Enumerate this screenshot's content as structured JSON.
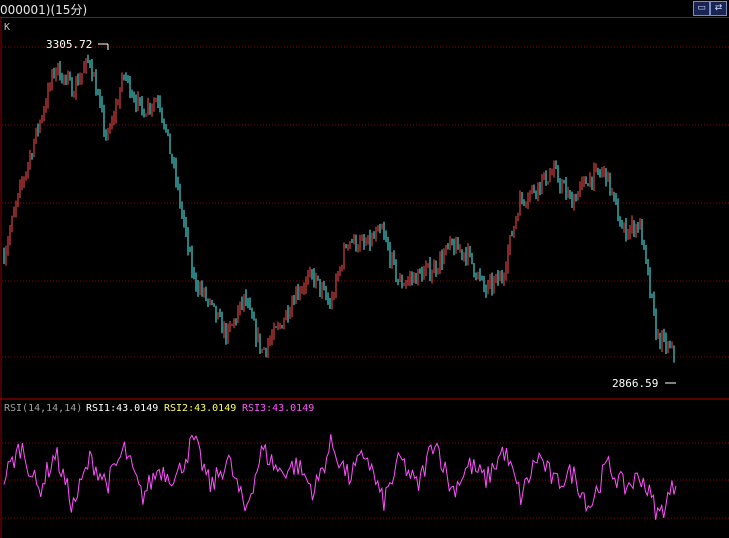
{
  "window": {
    "title": "000001)(15分)",
    "restore_icon": "restore-window-icon",
    "close_icon": "swap-window-icon"
  },
  "colors": {
    "up": "#ff5050",
    "down": "#54fcfc",
    "grid": "#8b0000",
    "rsi_line": "#ff50ff",
    "rsi1_label": "#ffffff",
    "rsi2_label": "#ffff54",
    "rsi3_label": "#ff54ff"
  },
  "panels": {
    "main_label": "K",
    "indicator_name": "RSI(14,14,14)",
    "rsi1_text": "RSI1:43.0149",
    "rsi2_text": "RSI2:43.0149",
    "rsi3_text": "RSI3:43.0149"
  },
  "chart_data": [
    {
      "type": "candlestick",
      "title": "K",
      "y_range": [
        2840,
        3345
      ],
      "grid": "horizontal dotted",
      "annotations": [
        {
          "label": "3305.72",
          "kind": "high"
        },
        {
          "label": "2866.59",
          "kind": "low"
        }
      ],
      "close_path": [
        3030,
        3120,
        3200,
        3280,
        3250,
        3290,
        3180,
        3270,
        3220,
        3240,
        3130,
        3000,
        2960,
        2920,
        2970,
        2900,
        2930,
        2980,
        3000,
        2960,
        3050,
        3040,
        3060,
        2990,
        3000,
        3010,
        3040,
        3030,
        2980,
        3000,
        3100,
        3120,
        3140,
        3100,
        3130,
        3140,
        3060,
        3070,
        2920,
        2895
      ]
    },
    {
      "type": "line",
      "title": "RSI(14,14,14)",
      "series": [
        {
          "name": "RSI1",
          "last": 43.0149
        },
        {
          "name": "RSI2",
          "last": 43.0149
        },
        {
          "name": "RSI3",
          "last": 43.0149
        }
      ],
      "rsi_path": [
        45,
        62,
        38,
        58,
        30,
        55,
        42,
        60,
        35,
        50,
        45,
        65,
        40,
        55,
        28,
        60,
        48,
        52,
        38,
        63,
        45,
        58,
        32,
        55,
        40,
        66,
        38,
        52,
        44,
        60,
        35,
        57,
        42,
        48,
        30,
        52,
        40,
        46,
        25,
        43
      ]
    }
  ]
}
